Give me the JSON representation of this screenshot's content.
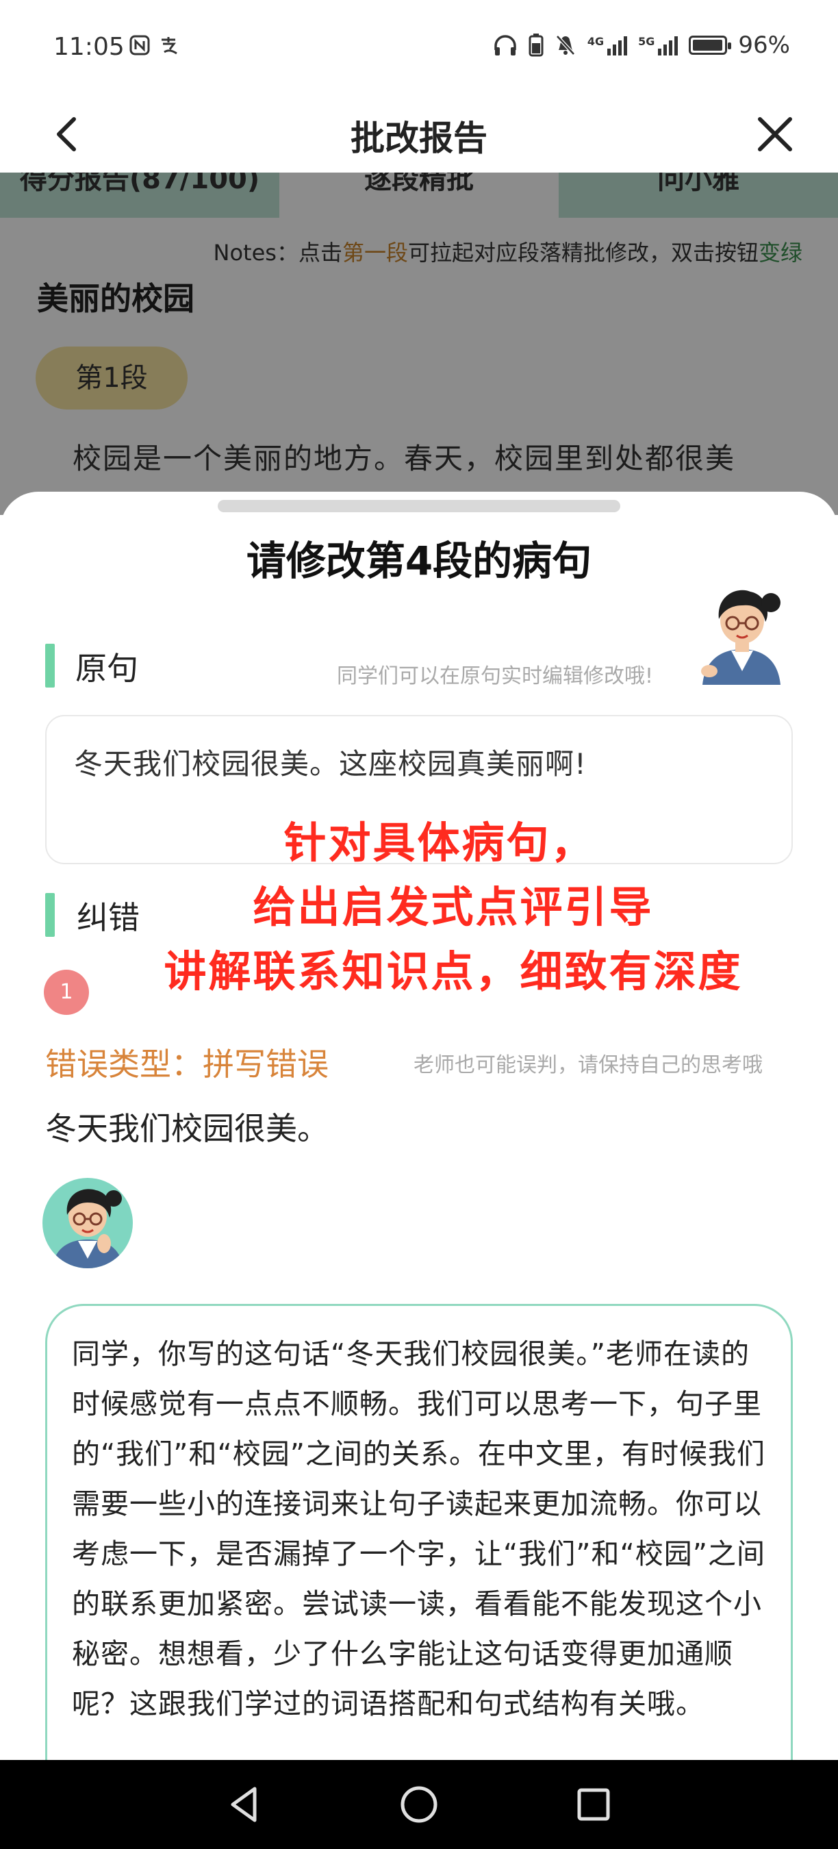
{
  "status_bar": {
    "time": "11:05",
    "left_icons": [
      "nfc-icon",
      "alipay-icon"
    ],
    "right_icons": [
      "headphones-icon",
      "phone-battery-icon",
      "mute-icon",
      "signal-4g-icon",
      "signal-5g-icon"
    ],
    "signal_labels": [
      "4G",
      "5G"
    ],
    "battery_percent": 96,
    "battery_label": "96%"
  },
  "header": {
    "title": "批改报告",
    "back_icon": "chevron-left-icon",
    "close_icon": "close-icon"
  },
  "background_page": {
    "tabs": [
      {
        "label": "得分报告(87/100)"
      },
      {
        "label": "逐段精批"
      },
      {
        "label": "问小雅"
      }
    ],
    "notes": {
      "prefix": "Notes：点击",
      "highlight1": "第一段",
      "middle": "可拉起对应段落精批修改，双击按钮",
      "highlight2": "变绿"
    },
    "essay_title": "美丽的校园",
    "paragraph_chip": "第1段",
    "paragraph_text": "校园是一个美丽的地方。春天，校园里到处都很美"
  },
  "sheet": {
    "title": "请修改第4段的病句",
    "original_section": {
      "label": "原句",
      "hint": "同学们可以在原句实时编辑修改哦!",
      "sentence": "冬天我们校园很美。这座校园真美丽啊!"
    },
    "promo_lines": [
      "针对具体病句，",
      "给出启发式点评引导",
      "讲解联系知识点，细致有深度"
    ],
    "correction_section": {
      "label": "纠错",
      "item_number": "1",
      "error_type": "错误类型：拼写错误",
      "disclaimer": "老师也可能误判，请保持自己的思考哦",
      "sentence": "冬天我们校园很美。",
      "teacher_comment": "同学，你写的这句话“冬天我们校园很美。”老师在读的时候感觉有一点点不顺畅。我们可以思考一下，句子里的“我们”和“校园”之间的关系。在中文里，有时候我们需要一些小的连接词来让句子读起来更加流畅。你可以考虑一下，是否漏掉了一个字，让“我们”和“校园”之间的联系更加紧密。尝试读一读，看看能不能发现这个小秘密。想想看，少了什么字能让这句话变得更加通顺呢？这跟我们学过的词语搭配和句式结构有关哦。"
    }
  },
  "colors": {
    "accent_green": "#6fd3a5",
    "error_orange": "#d8843a",
    "promo_red": "#ff2b1f",
    "badge_pink": "#f08585"
  },
  "system_nav": {
    "buttons": [
      "back-triangle-icon",
      "home-circle-icon",
      "recents-square-icon"
    ]
  }
}
